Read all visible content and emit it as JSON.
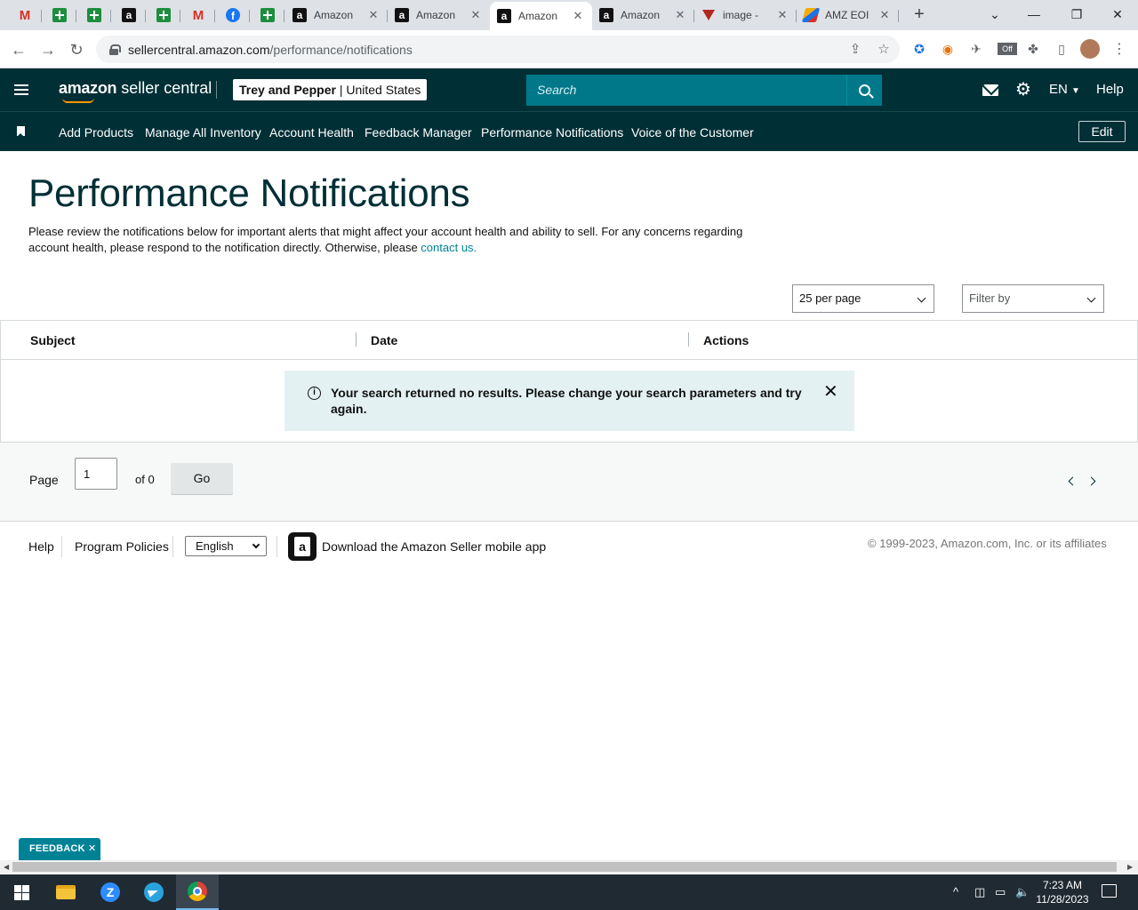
{
  "browser": {
    "tabs": [
      {
        "icon": "gmail-icon",
        "title": ""
      },
      {
        "icon": "sheets-icon",
        "title": ""
      },
      {
        "icon": "sheets-icon",
        "title": ""
      },
      {
        "icon": "amazon-icon",
        "title": ""
      },
      {
        "icon": "sheets-icon",
        "title": ""
      },
      {
        "icon": "gmail-icon",
        "title": ""
      },
      {
        "icon": "facebook-icon",
        "title": ""
      },
      {
        "icon": "sheets-icon",
        "title": ""
      },
      {
        "icon": "amazon-icon",
        "title": "Amazon"
      },
      {
        "icon": "amazon-icon",
        "title": "Amazon"
      },
      {
        "icon": "amazon-icon",
        "title": "Amazon",
        "active": true
      },
      {
        "icon": "amazon-icon",
        "title": "Amazon"
      },
      {
        "icon": "triangle-icon",
        "title": "image - "
      },
      {
        "icon": "pen-icon",
        "title": "AMZ EOI"
      }
    ],
    "url_host": "sellercentral.amazon.com",
    "url_path": "/performance/notifications"
  },
  "header": {
    "logo_brand": "amazon",
    "logo_product": "seller central",
    "account_name": "Trey and Pepper",
    "account_sep": " | ",
    "account_region": "United States",
    "search_placeholder": "Search",
    "lang": "EN",
    "help": "Help"
  },
  "nav": {
    "links": [
      "Add Products",
      "Manage All Inventory",
      "Account Health",
      "Feedback Manager",
      "Performance Notifications",
      "Voice of the Customer"
    ],
    "edit": "Edit"
  },
  "main": {
    "title": "Performance Notifications",
    "intro_text": "Please review the notifications below for important alerts that might affect your account health and ability to sell. For any concerns regarding account health, please respond to the notification directly. Otherwise, please ",
    "intro_link": "contact us.",
    "per_page": "25 per page",
    "filter_placeholder": "Filter by",
    "columns": [
      "Subject",
      "Date",
      "Actions"
    ],
    "alert_text": "Your search returned no results. Please change your search parameters and try again."
  },
  "pager": {
    "page_label": "Page",
    "page_value": "1",
    "of_label": "of 0",
    "go": "Go"
  },
  "footer": {
    "help": "Help",
    "policies": "Program Policies",
    "language": "English",
    "app_text": "Download the Amazon Seller mobile app",
    "copyright": "© 1999-2023, Amazon.com, Inc. or its affiliates"
  },
  "feedback": "FEEDBACK ✕",
  "taskbar": {
    "time": "7:23 AM",
    "date": "11/28/2023"
  }
}
